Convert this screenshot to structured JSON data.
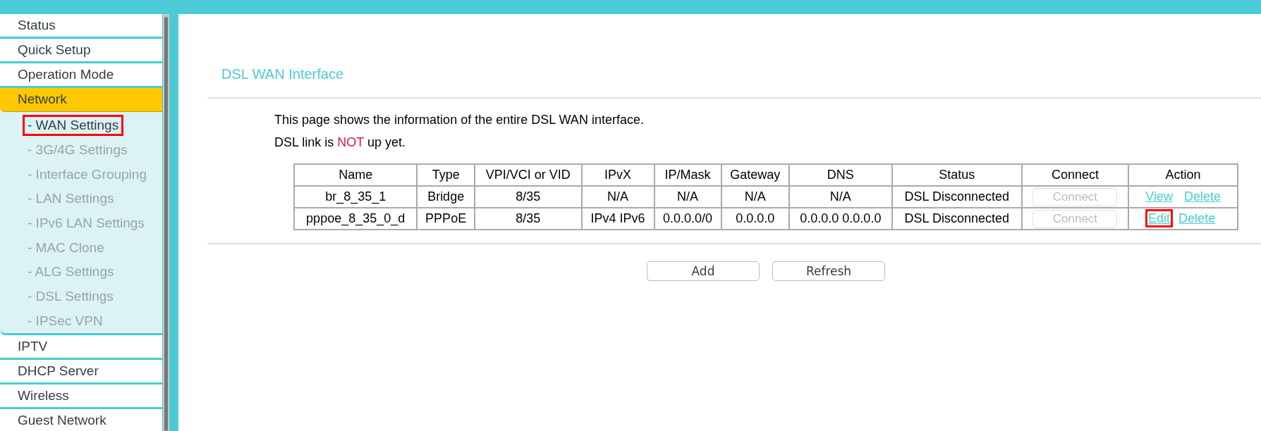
{
  "sidebar": {
    "items": [
      {
        "label": "Status",
        "selected": false
      },
      {
        "label": "Quick Setup",
        "selected": false
      },
      {
        "label": "Operation Mode",
        "selected": false
      },
      {
        "label": "Network",
        "selected": true,
        "children": [
          {
            "label": "- WAN Settings",
            "selected": true,
            "highlighted": true
          },
          {
            "label": "- 3G/4G Settings",
            "selected": false,
            "highlighted": false
          },
          {
            "label": "- Interface Grouping",
            "selected": false,
            "highlighted": false
          },
          {
            "label": "- LAN Settings",
            "selected": false,
            "highlighted": false
          },
          {
            "label": "- IPv6 LAN Settings",
            "selected": false,
            "highlighted": false
          },
          {
            "label": "- MAC Clone",
            "selected": false,
            "highlighted": false
          },
          {
            "label": "- ALG Settings",
            "selected": false,
            "highlighted": false
          },
          {
            "label": "- DSL Settings",
            "selected": false,
            "highlighted": false
          },
          {
            "label": "- IPSec VPN",
            "selected": false,
            "highlighted": false
          }
        ]
      },
      {
        "label": "IPTV",
        "selected": false
      },
      {
        "label": "DHCP Server",
        "selected": false
      },
      {
        "label": "Wireless",
        "selected": false
      },
      {
        "label": "Guest Network",
        "selected": false
      }
    ]
  },
  "main": {
    "title": "DSL WAN Interface",
    "description": "This page shows the information of the entire DSL WAN interface.",
    "link_status": "DSL link is **NOT** up yet.",
    "table": {
      "columns": [
        "Name",
        "Type",
        "VPI/VCI or VID",
        "IPvX",
        "IP/Mask",
        "Gateway",
        "DNS",
        "Status",
        "Connect",
        "Action"
      ],
      "rows": [
        {
          "cells": [
            "br_8_35_1",
            "Bridge",
            "8/35",
            "N/A",
            "N/A",
            "N/A",
            "N/A",
            "DSL  Disconnected"
          ],
          "connect": {
            "label": "Connect",
            "disabled": true
          },
          "actions": [
            {
              "label": "View",
              "highlighted": false
            },
            {
              "label": "Delete",
              "highlighted": false
            }
          ]
        },
        {
          "cells": [
            "pppoe_8_35_0_d",
            "PPPoE",
            "8/35",
            "IPv4 IPv6",
            "0.0.0.0/0",
            "0.0.0.0",
            "0.0.0.0 0.0.0.0",
            "DSL  Disconnected"
          ],
          "connect": {
            "label": "Connect",
            "disabled": true
          },
          "actions": [
            {
              "label": "Edit",
              "highlighted": true
            },
            {
              "label": "Delete",
              "highlighted": false
            }
          ]
        }
      ]
    },
    "buttons": [
      "Add",
      "Refresh"
    ]
  }
}
